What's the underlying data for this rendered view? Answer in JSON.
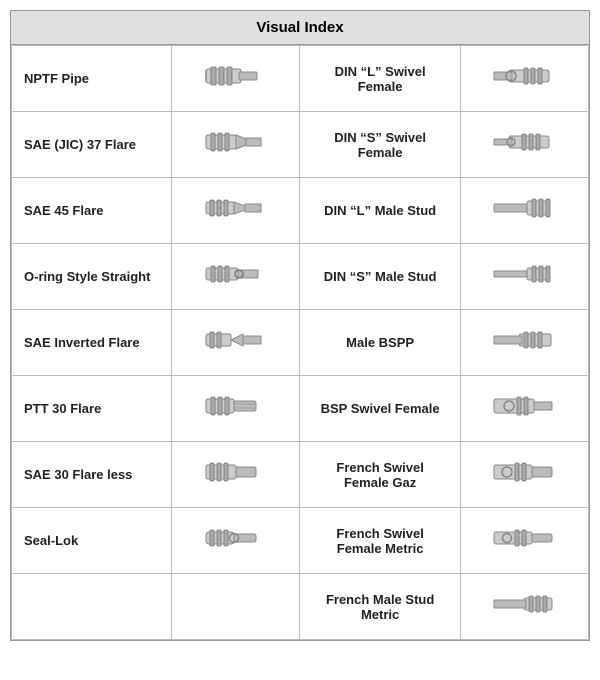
{
  "title": "Visual Index",
  "rows": [
    {
      "left_label": "NPTF Pipe",
      "left_icon": "nptf",
      "right_label": "DIN “L” Swivel Female",
      "right_icon": "din-l-swivel-female"
    },
    {
      "left_label": "SAE (JIC) 37 Flare",
      "left_icon": "sae-jic-37",
      "right_label": "DIN “S” Swivel Female",
      "right_icon": "din-s-swivel-female"
    },
    {
      "left_label": "SAE 45 Flare",
      "left_icon": "sae-45",
      "right_label": "DIN “L” Male Stud",
      "right_icon": "din-l-male-stud"
    },
    {
      "left_label": "O-ring Style Straight",
      "left_icon": "oring-straight",
      "right_label": "DIN “S” Male Stud",
      "right_icon": "din-s-male-stud"
    },
    {
      "left_label": "SAE Inverted Flare",
      "left_icon": "sae-inverted",
      "right_label": "Male BSPP",
      "right_icon": "male-bspp"
    },
    {
      "left_label": "PTT 30 Flare",
      "left_icon": "ptt-30",
      "right_label": "BSP Swivel Female",
      "right_icon": "bsp-swivel-female"
    },
    {
      "left_label": "SAE 30 Flare less",
      "left_icon": "sae-30-flareless",
      "right_label": "French Swivel Female Gaz",
      "right_icon": "french-swivel-gaz"
    },
    {
      "left_label": "Seal-Lok",
      "left_icon": "seal-lok",
      "right_label": "French Swivel Female Metric",
      "right_icon": "french-swivel-metric"
    },
    {
      "left_label": "",
      "left_icon": "empty",
      "right_label": "French Male Stud Metric",
      "right_icon": "french-male-stud-metric"
    }
  ],
  "colors": {
    "header_bg": "#e0e0e0",
    "border": "#999999",
    "text": "#222222"
  }
}
